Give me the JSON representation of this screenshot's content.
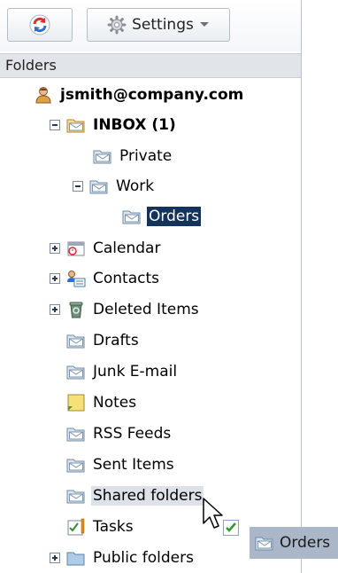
{
  "toolbar": {
    "refresh_icon": "refresh-icon",
    "settings_label": "Settings",
    "settings_icon": "gear-icon",
    "dropdown_icon": "chevron-down-icon"
  },
  "folders_header": "Folders",
  "tree": {
    "account": "jsmith@company.com",
    "inbox": "INBOX (1)",
    "private": "Private",
    "work": "Work",
    "orders": "Orders",
    "calendar": "Calendar",
    "contacts": "Contacts",
    "deleted_items": "Deleted Items",
    "drafts": "Drafts",
    "junk": "Junk E-mail",
    "notes": "Notes",
    "rss": "RSS Feeds",
    "sent": "Sent Items",
    "shared": "Shared folders",
    "tasks": "Tasks",
    "public": "Public folders"
  },
  "drag": {
    "label": "Orders",
    "check_icon": "checkmark-icon",
    "cursor_icon": "move-cursor-icon"
  },
  "colors": {
    "selection": "#13325c",
    "header_bg": "#e1e5ea",
    "accent_red": "#cc3333",
    "accent_blue": "#2a6fd1"
  }
}
